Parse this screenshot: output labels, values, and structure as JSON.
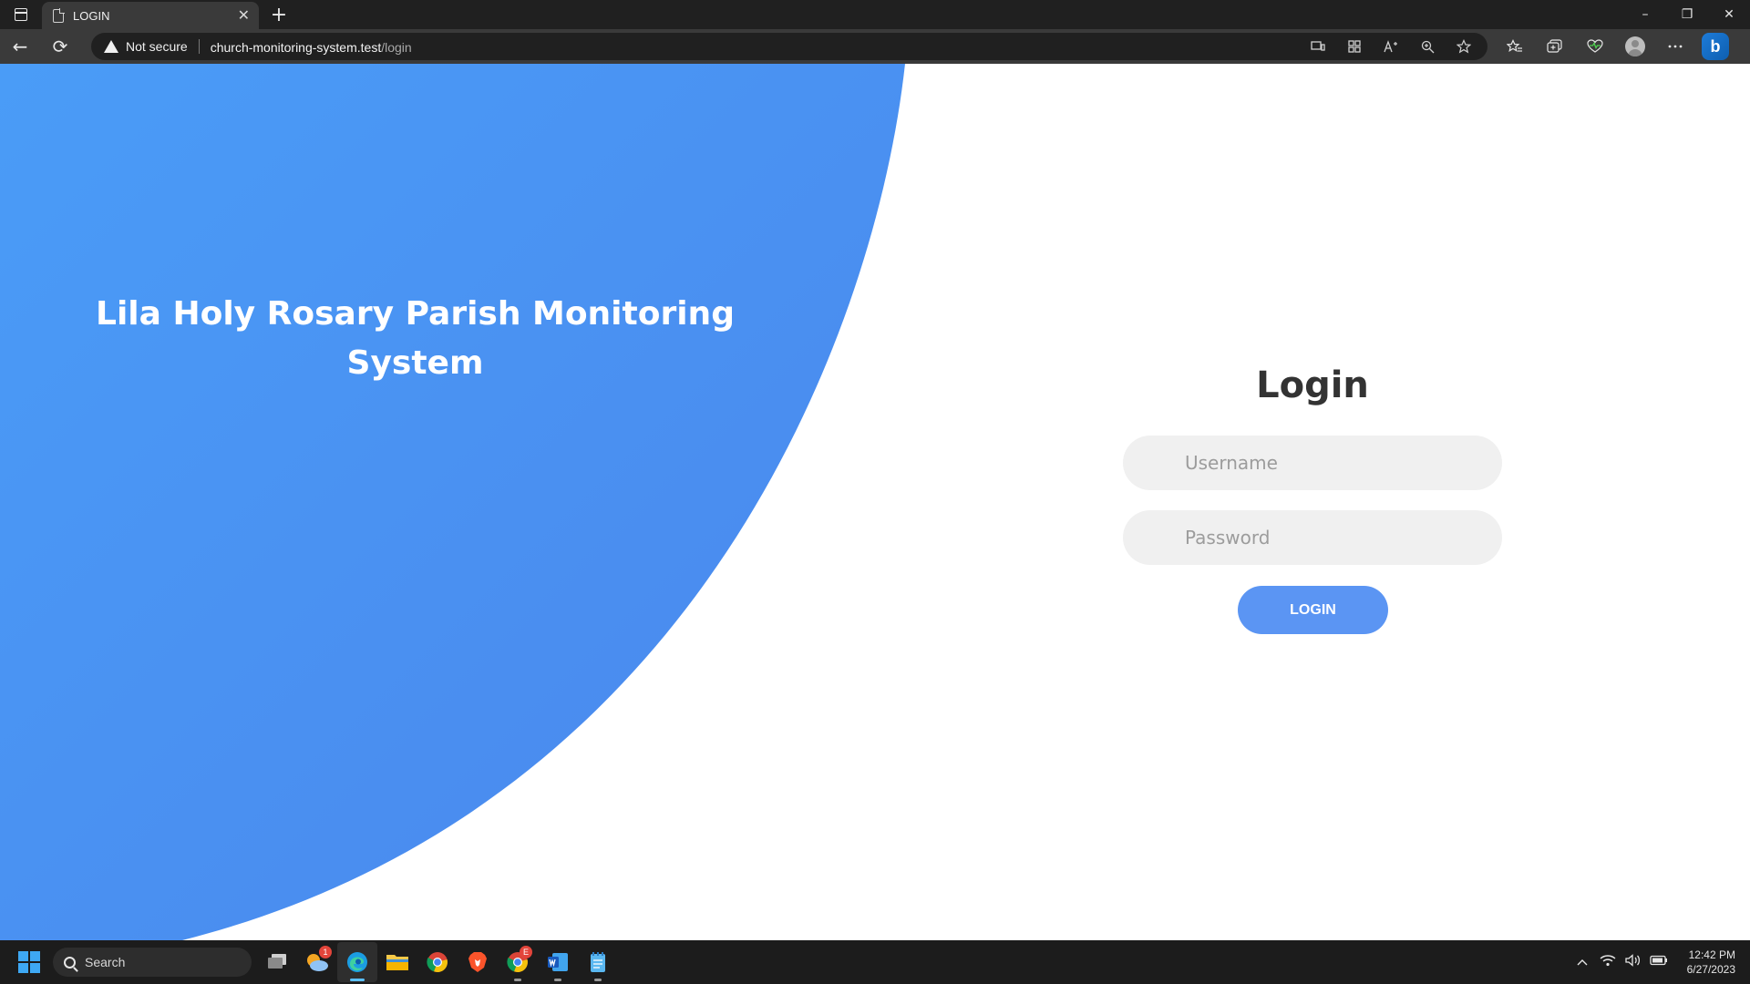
{
  "browser": {
    "tab_title": "LOGIN",
    "tab_close": "✕",
    "new_tab": "+",
    "security_label": "Not secure",
    "url_host": "church-monitoring-system.test",
    "url_path": "/login",
    "window_controls": {
      "minimize": "–",
      "restore": "❐",
      "close": "✕"
    },
    "nav": {
      "back": "←",
      "reload": "⟳"
    }
  },
  "page": {
    "hero_title": "Lila Holy Rosary Parish Monitoring System",
    "login_title": "Login",
    "username_placeholder": "Username",
    "password_placeholder": "Password",
    "login_button": "LOGIN",
    "accent_color": "#4a90f0",
    "button_color": "#5b95f3"
  },
  "taskbar": {
    "search_label": "Search",
    "apps": [
      {
        "name": "task-view",
        "badge": ""
      },
      {
        "name": "widgets",
        "badge": "1"
      },
      {
        "name": "edge",
        "badge": "",
        "active": true
      },
      {
        "name": "file-explorer",
        "badge": ""
      },
      {
        "name": "chrome",
        "badge": ""
      },
      {
        "name": "brave",
        "badge": ""
      },
      {
        "name": "chrome-profile",
        "badge": "E"
      },
      {
        "name": "word",
        "badge": ""
      },
      {
        "name": "notepad",
        "badge": ""
      }
    ],
    "clock_time": "12:42 PM",
    "clock_date": "6/27/2023"
  }
}
